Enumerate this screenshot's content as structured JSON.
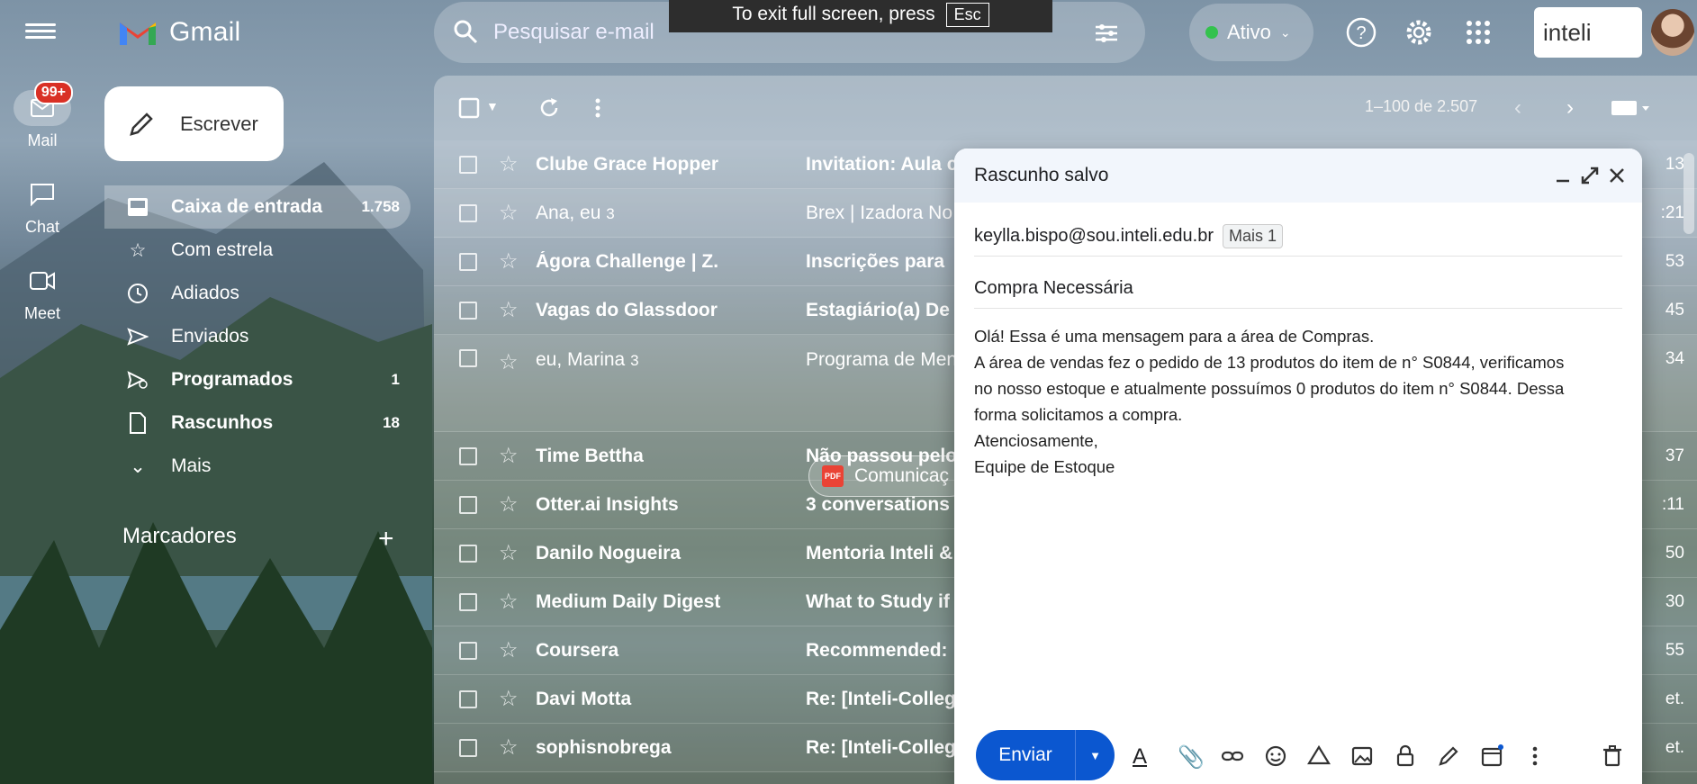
{
  "app": {
    "logo_text": "Gmail",
    "accent": "#0b57d0"
  },
  "fullscreen_notice": {
    "text": "To exit full screen, press",
    "key": "Esc"
  },
  "search": {
    "placeholder": "Pesquisar e-mail"
  },
  "status": {
    "label": "Ativo",
    "color": "#33c24d"
  },
  "org_logo": {
    "text": "inteli"
  },
  "rail": {
    "mail": {
      "label": "Mail",
      "badge": "99+"
    },
    "chat": {
      "label": "Chat"
    },
    "meet": {
      "label": "Meet"
    }
  },
  "compose_button": {
    "label": "Escrever"
  },
  "nav": [
    {
      "label": "Caixa de entrada",
      "count": "1.758",
      "icon": "inbox-icon"
    },
    {
      "label": "Com estrela",
      "count": "",
      "icon": "star-icon"
    },
    {
      "label": "Adiados",
      "count": "",
      "icon": "clock-icon"
    },
    {
      "label": "Enviados",
      "count": "",
      "icon": "send-icon"
    },
    {
      "label": "Programados",
      "count": "1",
      "icon": "scheduled-icon"
    },
    {
      "label": "Rascunhos",
      "count": "18",
      "icon": "draft-icon"
    },
    {
      "label": "Mais",
      "count": "",
      "icon": "chevron-down-icon"
    }
  ],
  "labels_section": {
    "title": "Marcadores"
  },
  "list": {
    "pager": "1–100 de 2.507",
    "rows": [
      {
        "sender": "Clube Grace Hopper",
        "count": "",
        "subject": "Invitation: Aula c",
        "time": "13",
        "unread": true
      },
      {
        "sender": "Ana, eu",
        "count": "3",
        "subject": "Brex | Izadora No",
        "time": ":21",
        "unread": false
      },
      {
        "sender": "Ágora Challenge | Z.",
        "count": "",
        "subject": "Inscrições para",
        "time": "53",
        "unread": true
      },
      {
        "sender": "Vagas do Glassdoor",
        "count": "",
        "subject": "Estagiário(a) De",
        "time": "45",
        "unread": true
      },
      {
        "sender": "eu, Marina",
        "count": "3",
        "subject": "Programa de Men",
        "time": "34",
        "unread": false
      },
      {
        "sender": "Time Bettha",
        "count": "",
        "subject": "Não passou pelo",
        "time": "37",
        "unread": true
      },
      {
        "sender": "Otter.ai Insights",
        "count": "",
        "subject": "3 conversations",
        "time": ":11",
        "unread": true
      },
      {
        "sender": "Danilo Nogueira",
        "count": "",
        "subject": "Mentoria Inteli &",
        "time": "50",
        "unread": true
      },
      {
        "sender": "Medium Daily Digest",
        "count": "",
        "subject": "What to Study if",
        "time": "30",
        "unread": true
      },
      {
        "sender": "Coursera",
        "count": "",
        "subject": "Recommended:",
        "time": "55",
        "unread": true
      },
      {
        "sender": "Davi Motta",
        "count": "",
        "subject": "Re: [Inteli-Colleg",
        "time": "et.",
        "unread": true
      },
      {
        "sender": "sophisnobrega",
        "count": "",
        "subject": "Re: [Inteli-Colleg",
        "time": "et.",
        "unread": true
      }
    ],
    "attachment_chip": "Comunicaç"
  },
  "compose": {
    "title": "Rascunho salvo",
    "to": "keylla.bispo@sou.inteli.edu.br",
    "more": "Mais 1",
    "subject": "Compra Necessária",
    "body": [
      "Olá! Essa é uma mensagem para a área de Compras.",
      "A área de vendas fez o pedido de 13 produtos do item de n° S0844, verificamos",
      "no nosso estoque e atualmente possuímos 0 produtos do item n° S0844. Dessa",
      "forma solicitamos a compra.",
      "",
      "Atenciosamente,",
      "Equipe de Estoque"
    ],
    "send_label": "Enviar"
  }
}
